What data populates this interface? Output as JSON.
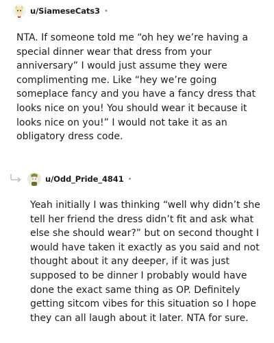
{
  "comments": [
    {
      "username": "u/SiameseCats3",
      "separator": "•",
      "avatar_icon": "siamese-cat-avatar-icon",
      "body": "NTA. If someone told me “oh hey we’re having a special dinner wear that dress from your anniversary” I would just assume they were complimenting me. Like “hey we’re going someplace fancy and you have a fancy dress that looks nice on you! You should wear it because it looks nice on you!” I would not take it as an obligatory dress code."
    },
    {
      "username": "u/Odd_Pride_4841",
      "separator": "•",
      "avatar_icon": "snoo-avatar-icon",
      "reply_icon": "reply-arrow-icon",
      "body": "Yeah initially I was thinking “well why didn’t she tell her friend the dress didn’t fit and ask what else she should wear?” but on second thought I would have taken it exactly as you said and not thought about it any deeper, if it was just supposed to be dinner I probably would have done the exact same thing as OP. Definitely getting sitcom vibes for this situation so I hope they can all laugh about it later. NTA for sure."
    }
  ]
}
